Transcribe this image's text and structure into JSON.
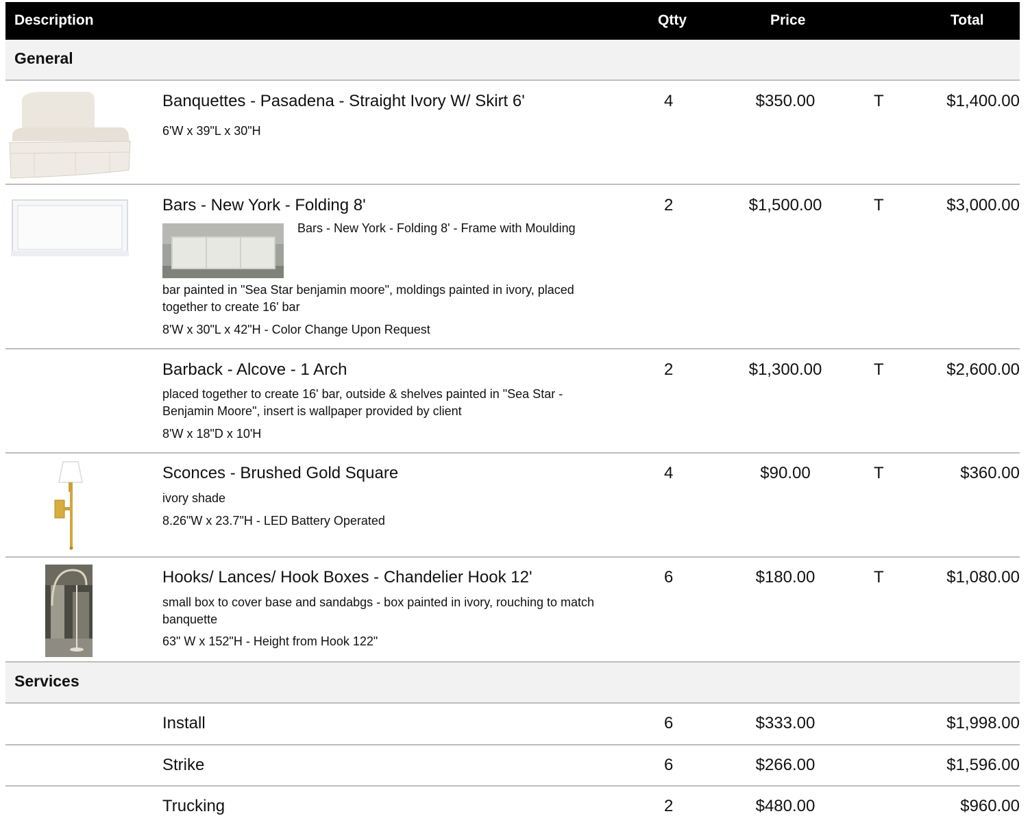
{
  "header": {
    "description": "Description",
    "qty": "Qtty",
    "price": "Price",
    "total": "Total"
  },
  "sections": {
    "general": "General",
    "services": "Services"
  },
  "items": [
    {
      "name": "Banquettes - Pasadena - Straight Ivory W/ Skirt 6'",
      "dims": "6'W x 39\"L x 30\"H",
      "qty": "4",
      "price": "$350.00",
      "tax": "T",
      "total": "$1,400.00"
    },
    {
      "name": "Bars - New York -  Folding 8'",
      "variant": "Bars - New York -  Folding 8'  - Frame with Moulding",
      "note": "bar painted in \"Sea Star benjamin moore\", moldings painted in ivory, placed together to create 16' bar",
      "dims": "8'W x 30\"L x 42\"H - Color Change Upon Request",
      "qty": "2",
      "price": "$1,500.00",
      "tax": "T",
      "total": "$3,000.00"
    },
    {
      "name": "Barback - Alcove - 1 Arch",
      "note": "placed together to create 16' bar, outside & shelves painted in \"Sea Star - Benjamin Moore\", insert is wallpaper provided by client",
      "dims": "8'W x 18\"D x 10'H",
      "qty": "2",
      "price": "$1,300.00",
      "tax": "T",
      "total": "$2,600.00"
    },
    {
      "name": "Sconces - Brushed Gold Square",
      "note": "ivory shade",
      "dims": "8.26\"W x 23.7\"H - LED Battery Operated",
      "qty": "4",
      "price": "$90.00",
      "tax": "T",
      "total": "$360.00"
    },
    {
      "name": "Hooks/ Lances/ Hook Boxes - Chandelier Hook 12'",
      "note": "small box to cover base and sandabgs - box painted in ivory, rouching to match banquette",
      "dims": "63\" W x 152\"H - Height from Hook 122\"",
      "qty": "6",
      "price": "$180.00",
      "tax": "T",
      "total": "$1,080.00"
    }
  ],
  "services": [
    {
      "name": "Install",
      "qty": "6",
      "price": "$333.00",
      "total": "$1,998.00"
    },
    {
      "name": "Strike",
      "qty": "6",
      "price": "$266.00",
      "total": "$1,596.00"
    },
    {
      "name": "Trucking",
      "qty": "2",
      "price": "$480.00",
      "total": "$960.00"
    }
  ],
  "icons": {
    "banquette": "banquette-photo",
    "bar": "bar-photo",
    "bar_variant": "bar-frame-photo",
    "sconce": "sconce-photo",
    "hook": "chandelier-hook-photo"
  }
}
